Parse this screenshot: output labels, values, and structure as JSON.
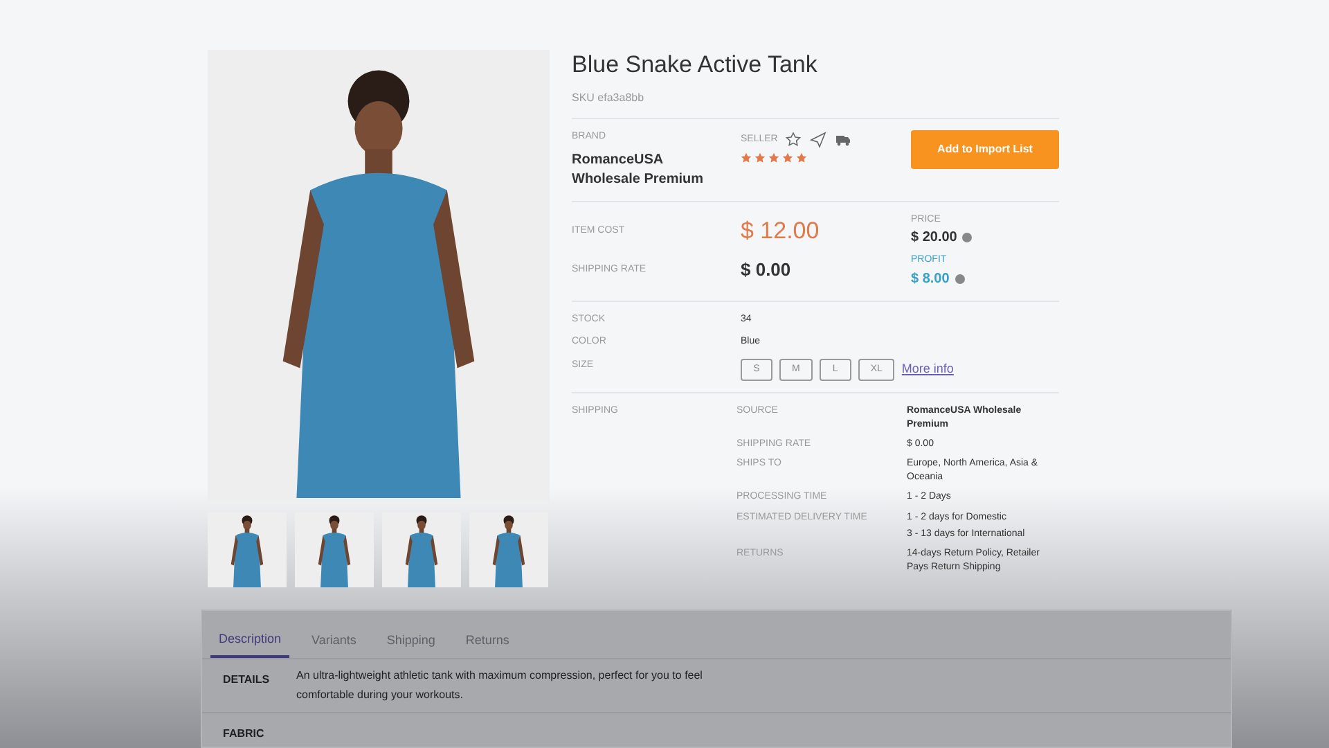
{
  "product": {
    "title": "Blue Snake Active Tank",
    "sku": "SKU efa3a8bb"
  },
  "thumbnails": [
    {
      "selected": false
    },
    {
      "selected": false
    },
    {
      "selected": false
    },
    {
      "selected": false
    }
  ],
  "brand": {
    "label": "BRAND",
    "name": "RomanceUSA Wholesale Premium"
  },
  "seller": {
    "label": "SELLER",
    "stars": 5
  },
  "import_button": "Add to Import List",
  "costs": {
    "item_cost_label": "ITEM COST",
    "item_cost": "$ 12.00",
    "shipping_rate_label": "SHIPPING RATE",
    "shipping_rate": "$ 0.00",
    "price_label": "PRICE",
    "price": "$ 20.00",
    "profit_label": "PROFIT",
    "profit": "$ 8.00"
  },
  "attributes": [
    {
      "label": "STOCK",
      "value": "34"
    },
    {
      "label": "COLOR",
      "value": "Blue"
    }
  ],
  "size": {
    "label": "SIZE",
    "options": [
      {
        "label": "S",
        "selected": false
      },
      {
        "label": "M",
        "selected": false
      },
      {
        "label": "L",
        "selected": false
      },
      {
        "label": "XL",
        "selected": false
      }
    ],
    "link": "More info"
  },
  "shipping": {
    "label": "SHIPPING",
    "rows": [
      {
        "label": "SOURCE",
        "lines": [
          "RomanceUSA Wholesale Premium"
        ],
        "bold": true
      },
      {
        "label": "SHIPPING RATE",
        "lines": [
          "$ 0.00"
        ],
        "bold": false
      },
      {
        "label": "SHIPS TO",
        "lines": [
          "Europe, North America, Asia & Oceania"
        ],
        "bold": false
      },
      {
        "label": "PROCESSING TIME",
        "lines": [
          "1 - 2 Days"
        ],
        "bold": false
      },
      {
        "label": "ESTIMATED DELIVERY TIME",
        "lines": [
          "1 - 2 days for Domestic",
          "3 - 13 days for International"
        ],
        "bold": false
      },
      {
        "label": "RETURNS",
        "lines": [
          "14-days Return Policy, Retailer Pays Return Shipping"
        ],
        "bold": false
      }
    ]
  },
  "tabs": [
    {
      "label": "Description",
      "selected": true
    },
    {
      "label": "Variants",
      "selected": false
    },
    {
      "label": "Shipping",
      "selected": false
    },
    {
      "label": "Returns",
      "selected": false
    }
  ],
  "description": [
    {
      "label": "DETAILS",
      "text": "An ultra-lightweight athletic tank with maximum compression, perfect for you to feel comfortable during your workouts."
    },
    {
      "label": "FABRIC"
    }
  ]
}
